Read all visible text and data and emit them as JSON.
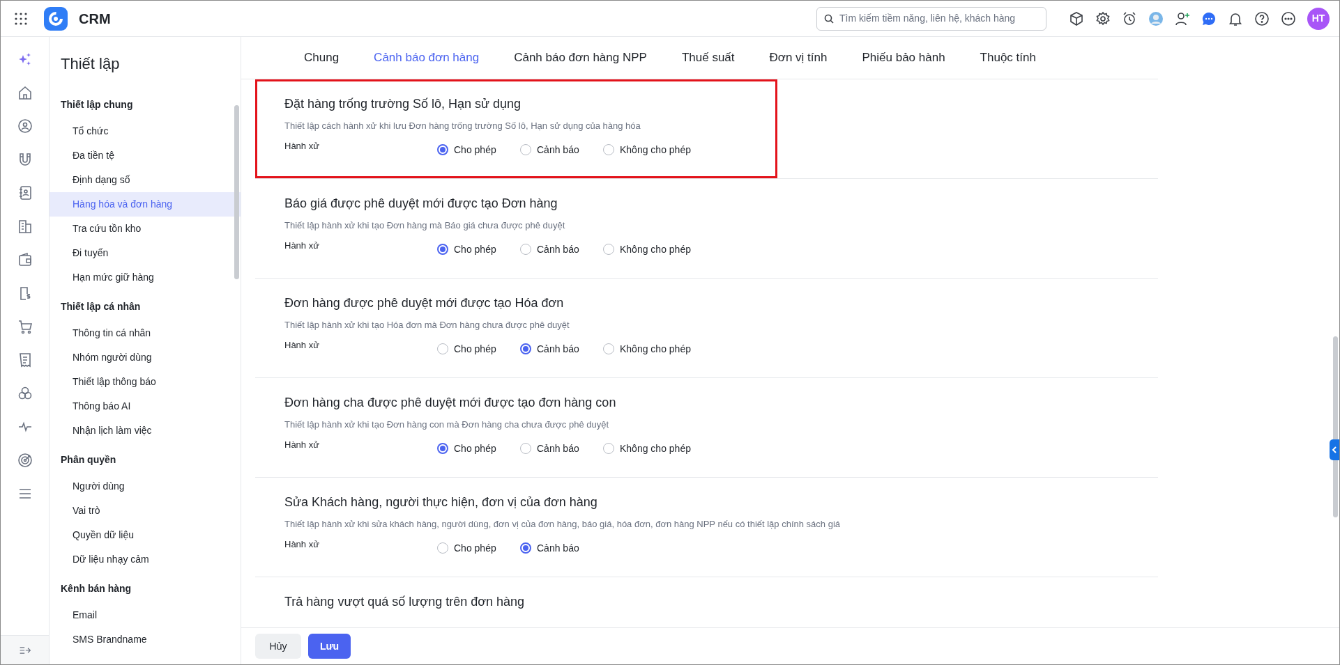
{
  "app": {
    "name": "CRM"
  },
  "search": {
    "placeholder": "Tìm kiếm tiềm năng, liên hệ, khách hàng"
  },
  "user": {
    "initials": "HT"
  },
  "sidebar": {
    "title": "Thiết lập",
    "groups": [
      {
        "label": "Thiết lập chung",
        "items": [
          {
            "label": "Tổ chức",
            "selected": false
          },
          {
            "label": "Đa tiền tệ",
            "selected": false
          },
          {
            "label": "Định dạng số",
            "selected": false
          },
          {
            "label": "Hàng hóa và đơn hàng",
            "selected": true
          },
          {
            "label": "Tra cứu tồn kho",
            "selected": false
          },
          {
            "label": "Đi tuyến",
            "selected": false
          },
          {
            "label": "Hạn mức giữ hàng",
            "selected": false
          }
        ]
      },
      {
        "label": "Thiết lập cá nhân",
        "items": [
          {
            "label": "Thông tin cá nhân",
            "selected": false
          },
          {
            "label": "Nhóm người dùng",
            "selected": false
          },
          {
            "label": "Thiết lập thông báo",
            "selected": false
          },
          {
            "label": "Thông báo AI",
            "selected": false
          },
          {
            "label": "Nhận lịch làm việc",
            "selected": false
          }
        ]
      },
      {
        "label": "Phân quyền",
        "items": [
          {
            "label": "Người dùng",
            "selected": false
          },
          {
            "label": "Vai trò",
            "selected": false
          },
          {
            "label": "Quyền dữ liệu",
            "selected": false
          },
          {
            "label": "Dữ liệu nhạy cảm",
            "selected": false
          }
        ]
      },
      {
        "label": "Kênh bán hàng",
        "items": [
          {
            "label": "Email",
            "selected": false
          },
          {
            "label": "SMS Brandname",
            "selected": false
          }
        ]
      }
    ]
  },
  "tabs": [
    {
      "label": "Chung",
      "selected": false
    },
    {
      "label": "Cảnh báo đơn hàng",
      "selected": true
    },
    {
      "label": "Cảnh báo đơn hàng NPP",
      "selected": false
    },
    {
      "label": "Thuế suất",
      "selected": false
    },
    {
      "label": "Đơn vị tính",
      "selected": false
    },
    {
      "label": "Phiếu bảo hành",
      "selected": false
    },
    {
      "label": "Thuộc tính",
      "selected": false
    }
  ],
  "sections": [
    {
      "title": "Đặt hàng trống trường Số lô, Hạn sử dụng",
      "description": "Thiết lập cách hành xử khi lưu Đơn hàng trống trường Số lô, Hạn sử dụng của hàng hóa",
      "highlighted": true,
      "behavior_label": "Hành xử",
      "options": [
        {
          "label": "Cho phép",
          "selected": true
        },
        {
          "label": "Cảnh báo",
          "selected": false
        },
        {
          "label": "Không cho phép",
          "selected": false
        }
      ]
    },
    {
      "title": "Báo giá được phê duyệt mới được tạo Đơn hàng",
      "description": "Thiết lập hành xử khi tạo Đơn hàng mà Báo giá chưa được phê duyệt",
      "highlighted": false,
      "behavior_label": "Hành xử",
      "options": [
        {
          "label": "Cho phép",
          "selected": true
        },
        {
          "label": "Cảnh báo",
          "selected": false
        },
        {
          "label": "Không cho phép",
          "selected": false
        }
      ]
    },
    {
      "title": "Đơn hàng được phê duyệt mới được tạo Hóa đơn",
      "description": "Thiết lập hành xử khi tạo Hóa đơn mà Đơn hàng chưa được phê duyệt",
      "highlighted": false,
      "behavior_label": "Hành xử",
      "options": [
        {
          "label": "Cho phép",
          "selected": false
        },
        {
          "label": "Cảnh báo",
          "selected": true
        },
        {
          "label": "Không cho phép",
          "selected": false
        }
      ]
    },
    {
      "title": "Đơn hàng cha được phê duyệt mới được tạo đơn hàng con",
      "description": "Thiết lập hành xử khi tạo Đơn hàng con mà Đơn hàng cha chưa được phê duyệt",
      "highlighted": false,
      "behavior_label": "Hành xử",
      "options": [
        {
          "label": "Cho phép",
          "selected": true
        },
        {
          "label": "Cảnh báo",
          "selected": false
        },
        {
          "label": "Không cho phép",
          "selected": false
        }
      ]
    },
    {
      "title": "Sửa Khách hàng, người thực hiện, đơn vị của đơn hàng",
      "description": "Thiết lập hành xử khi sửa khách hàng, người dùng, đơn vị của đơn hàng, báo giá, hóa đơn, đơn hàng NPP nếu có thiết lập chính sách giá",
      "highlighted": false,
      "behavior_label": "Hành xử",
      "options": [
        {
          "label": "Cho phép",
          "selected": false
        },
        {
          "label": "Cảnh báo",
          "selected": true
        }
      ]
    },
    {
      "title": "Trả hàng vượt quá số lượng trên đơn hàng",
      "highlighted": false
    }
  ],
  "footer": {
    "cancel": "Hủy",
    "save": "Lưu"
  }
}
